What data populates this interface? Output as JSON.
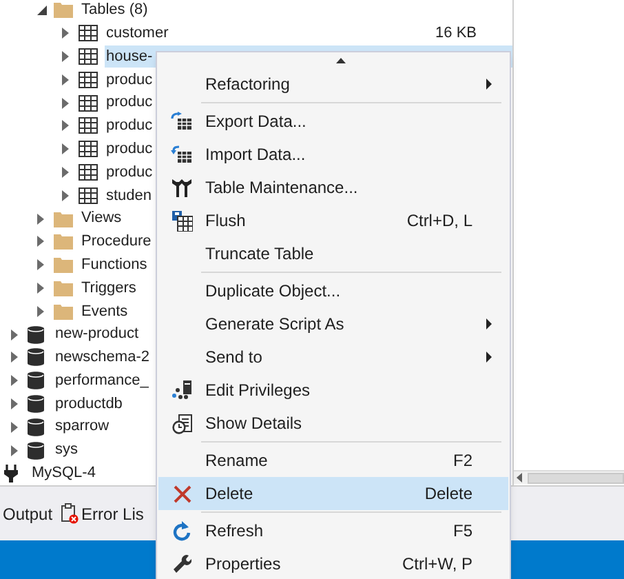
{
  "tree": [
    {
      "kind": "folder",
      "label": "Tables (8)",
      "expanded": true,
      "children": [
        {
          "kind": "table",
          "label": "customer",
          "size": "16 KB",
          "selected": false,
          "expanded": false
        },
        {
          "kind": "table",
          "label": "house-",
          "selected": true,
          "expanded": false
        },
        {
          "kind": "table",
          "label": "produc",
          "selected": false,
          "expanded": false
        },
        {
          "kind": "table",
          "label": "produc",
          "selected": false,
          "expanded": false
        },
        {
          "kind": "table",
          "label": "produc",
          "selected": false,
          "expanded": false
        },
        {
          "kind": "table",
          "label": "produc",
          "selected": false,
          "expanded": false
        },
        {
          "kind": "table",
          "label": "produc",
          "selected": false,
          "expanded": false
        },
        {
          "kind": "table",
          "label": "studen",
          "selected": false,
          "expanded": false
        }
      ]
    },
    {
      "kind": "folder",
      "label": "Views",
      "expanded": false
    },
    {
      "kind": "folder",
      "label": "Procedure",
      "expanded": false
    },
    {
      "kind": "folder",
      "label": "Functions",
      "expanded": false
    },
    {
      "kind": "folder",
      "label": "Triggers",
      "expanded": false
    },
    {
      "kind": "folder",
      "label": "Events",
      "expanded": false
    },
    {
      "kind": "database",
      "label": "new-product",
      "expanded": false
    },
    {
      "kind": "database",
      "label": "newschema-2",
      "expanded": false
    },
    {
      "kind": "database",
      "label": "performance_",
      "expanded": false
    },
    {
      "kind": "database",
      "label": "productdb",
      "expanded": false
    },
    {
      "kind": "database",
      "label": "sparrow",
      "expanded": false
    },
    {
      "kind": "database",
      "label": "sys",
      "expanded": false
    },
    {
      "kind": "connection",
      "label": "MySQL-4"
    }
  ],
  "panel_tabs": [
    {
      "label": "Output"
    },
    {
      "label": "Error Lis"
    }
  ],
  "context_menu": [
    {
      "kind": "scroll"
    },
    {
      "kind": "item",
      "label": "Refactoring",
      "submenu": true,
      "selected": false
    },
    {
      "kind": "separator"
    },
    {
      "kind": "item",
      "label": "Export Data...",
      "selected": false
    },
    {
      "kind": "item",
      "label": "Import Data...",
      "selected": false
    },
    {
      "kind": "item",
      "label": "Table Maintenance...",
      "selected": false
    },
    {
      "kind": "item",
      "label": "Flush",
      "shortcut": "Ctrl+D, L",
      "selected": false
    },
    {
      "kind": "item",
      "label": "Truncate Table",
      "selected": false
    },
    {
      "kind": "separator"
    },
    {
      "kind": "item",
      "label": "Duplicate Object...",
      "selected": false
    },
    {
      "kind": "item",
      "label": "Generate Script As",
      "submenu": true,
      "selected": false
    },
    {
      "kind": "item",
      "label": "Send to",
      "submenu": true,
      "selected": false
    },
    {
      "kind": "item",
      "label": "Edit Privileges",
      "selected": false
    },
    {
      "kind": "item",
      "label": "Show Details",
      "selected": false
    },
    {
      "kind": "separator"
    },
    {
      "kind": "item",
      "label": "Rename",
      "shortcut": "F2",
      "selected": false
    },
    {
      "kind": "item",
      "label": "Delete",
      "shortcut": "Delete",
      "selected": true
    },
    {
      "kind": "separator"
    },
    {
      "kind": "item",
      "label": "Refresh",
      "shortcut": "F5",
      "selected": false
    },
    {
      "kind": "item",
      "label": "Properties",
      "shortcut": "Ctrl+W, P",
      "selected": false
    }
  ]
}
